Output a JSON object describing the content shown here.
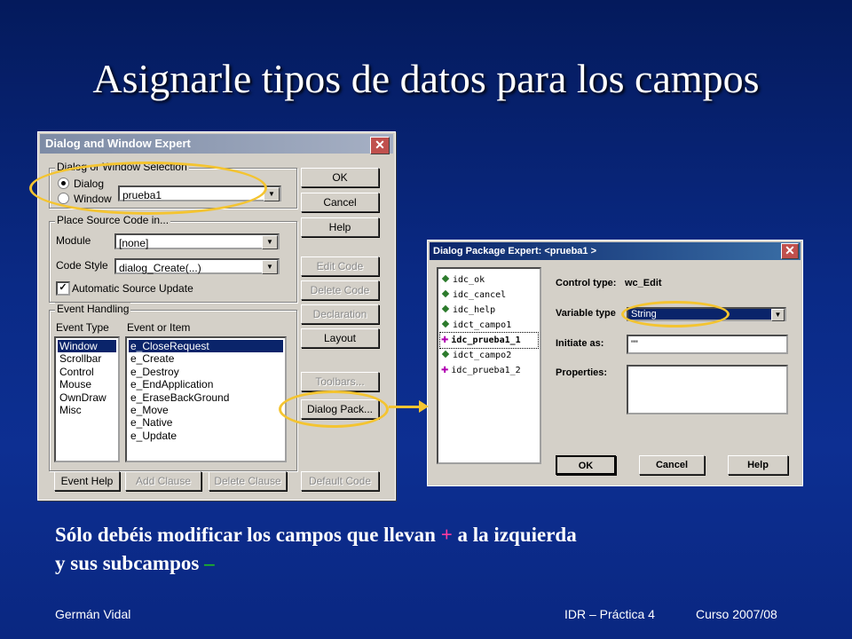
{
  "slide": {
    "title": "Asignarle tipos de datos para los campos",
    "caption_line1_before": "Sólo debéis modificar los campos que llevan ",
    "caption_plus": "+",
    "caption_line1_after": " a la izquierda",
    "caption_line2": "y sus subcampos ",
    "caption_minus": "–",
    "footer_author": "Germán Vidal",
    "footer_course": "IDR – Práctica 4",
    "footer_year": "Curso 2007/08"
  },
  "dialog_window_expert": {
    "title": "Dialog and Window Expert",
    "close_glyph": "✕",
    "selection_group": "Dialog or Window Selection",
    "radio_dialog": "Dialog",
    "radio_window": "Window",
    "selected_name": "prueba1",
    "source_group": "Place Source Code in...",
    "module_label": "Module",
    "module_value": "[none]",
    "code_style_label": "Code Style",
    "code_style_value": "dialog_Create(...)",
    "auto_update_label": "Automatic Source Update",
    "auto_update_checked": true,
    "event_group": "Event Handling",
    "event_type_header": "Event Type",
    "event_item_header": "Event or Item",
    "event_types": [
      "Window",
      "Scrollbar",
      "Control",
      "Mouse",
      "OwnDraw",
      "Misc"
    ],
    "event_items": [
      "e_CloseRequest",
      "e_Create",
      "e_Destroy",
      "e_EndApplication",
      "e_EraseBackGround",
      "e_Move",
      "e_Native",
      "e_Update"
    ],
    "buttons": {
      "ok": "OK",
      "cancel": "Cancel",
      "help": "Help",
      "edit_code": "Edit Code",
      "delete_code": "Delete Code",
      "declaration": "Declaration",
      "layout": "Layout",
      "toolbars": "Toolbars...",
      "dialog_pack": "Dialog Pack...",
      "event_help": "Event Help",
      "add_clause": "Add Clause",
      "delete_clause": "Delete Clause",
      "default_code": "Default Code"
    }
  },
  "dialog_package_expert": {
    "title": "Dialog Package Expert: <prueba1 >",
    "close_glyph": "✕",
    "tree_items": [
      "idc_ok",
      "idc_cancel",
      "idc_help",
      "idct_campo1",
      "idc_prueba1_1",
      "idct_campo2",
      "idc_prueba1_2"
    ],
    "control_type_label": "Control type:",
    "control_type_value": "wc_Edit",
    "variable_type_label": "Variable type",
    "variable_type_value": "String",
    "initiate_label": "Initiate as:",
    "initiate_value": "\"\"",
    "properties_label": "Properties:",
    "buttons": {
      "ok": "OK",
      "cancel": "Cancel",
      "help": "Help"
    }
  },
  "colors": {
    "highlight_ring": "#f4c430",
    "plus": "#ff3ba0",
    "minus": "#1fbf1f"
  }
}
